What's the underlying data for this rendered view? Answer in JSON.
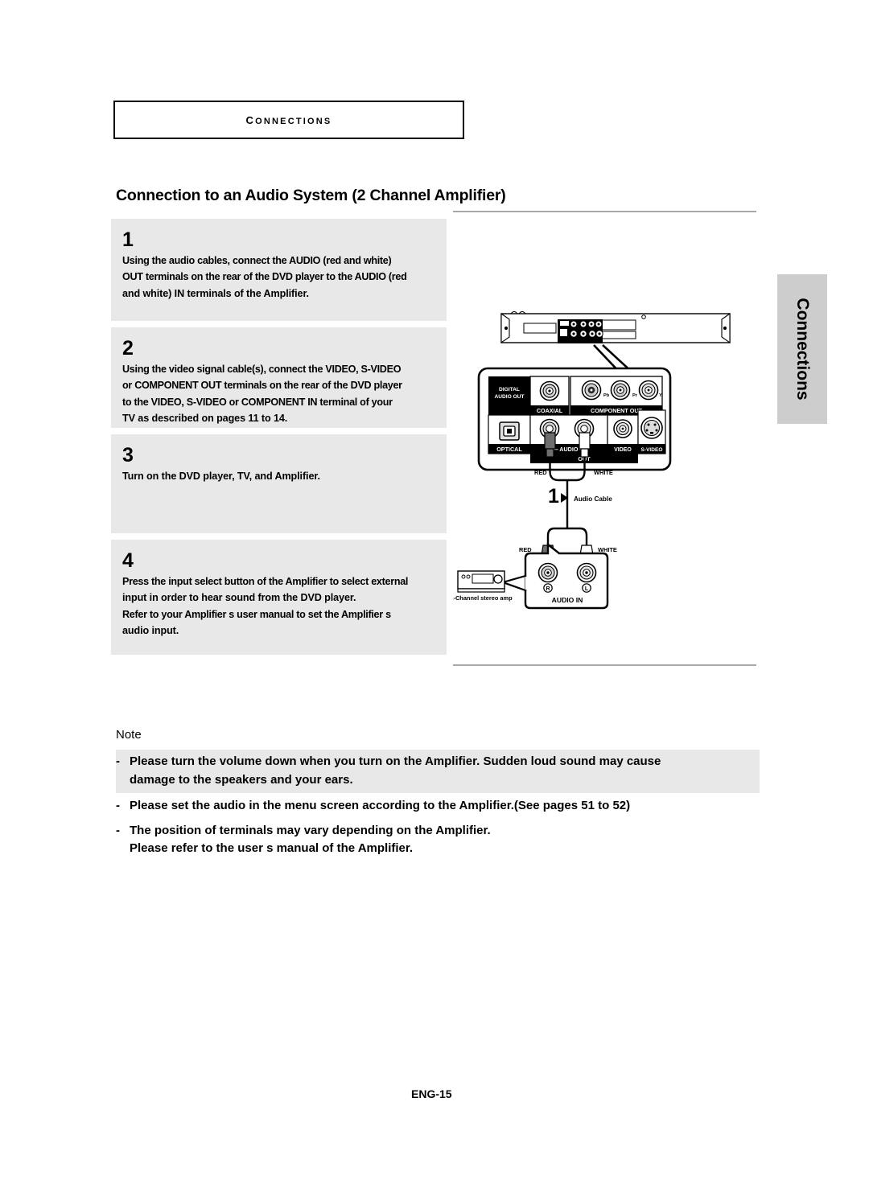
{
  "chapter": {
    "label": "Connections"
  },
  "section": {
    "title": "Connection to an Audio System (2 Channel Amplifier)"
  },
  "side_tab": {
    "label": "Connections"
  },
  "footer": {
    "page_label": "ENG-15"
  },
  "steps": [
    {
      "number": "1",
      "lines": [
        "Using the audio cables, connect the AUDIO (red and white)",
        "OUT terminals on the rear of the DVD player to the AUDIO (red",
        "and white) IN terminals of the Amplifier."
      ]
    },
    {
      "number": "2",
      "lines": [
        "Using the video signal cable(s), connect the VIDEO, S-VIDEO",
        "or COMPONENT OUT terminals on the rear of the DVD player",
        "to the VIDEO, S-VIDEO or COMPONENT IN terminal of your",
        "TV as described on pages 11 to 14."
      ]
    },
    {
      "number": "3",
      "lines": [
        "Turn on the DVD player, TV, and Amplifier."
      ]
    },
    {
      "number": "4",
      "lines": [
        "Press the input select button of the Amplifier to select external",
        "input  in order to hear sound from the DVD player.",
        "Refer to your Amplifier s user manual to set the Amplifier s",
        "audio input."
      ]
    }
  ],
  "note": {
    "heading": "Note",
    "items": [
      {
        "dash": "-",
        "shaded": true,
        "lines": [
          "Please turn the volume down when you turn on the Amplifier. Sudden loud sound may cause",
          "damage to the speakers and your ears."
        ]
      },
      {
        "dash": "-",
        "shaded": false,
        "lines": [
          "Please set the audio in the menu screen according to the Amplifier.(See pages 51 to 52)"
        ]
      },
      {
        "dash": "-",
        "shaded": false,
        "lines": [
          "The position of terminals may vary depending on the Amplifier.",
          "Please refer to the user s manual of the Amplifier."
        ]
      }
    ]
  },
  "diagram": {
    "rear_panel": {
      "digital_audio_out": "DIGITAL\nAUDIO OUT",
      "digital_audio_out_l1": "DIGITAL",
      "digital_audio_out_l2": "AUDIO OUT",
      "coaxial": "COAXIAL",
      "optical": "OPTICAL",
      "component_out": "COMPONENT OUT",
      "component_pb": "Pb",
      "component_pr": "Pr",
      "component_y": "Y",
      "audio": "AUDIO",
      "video": "VIDEO",
      "svideo": "S-VIDEO",
      "out": "OUT"
    },
    "cable": {
      "step_marker": "1",
      "label": "Audio Cable",
      "out_red": "RED",
      "out_white": "WHITE",
      "in_red": "RED",
      "in_white": "WHITE"
    },
    "amplifier": {
      "audio_in": "AUDIO IN",
      "jack_right": "R",
      "jack_left": "L",
      "caption": "2-Channel stereo amp"
    }
  },
  "colors": {
    "step_box_bg": "#e8e8e8",
    "side_tab_bg": "#cdcdcd",
    "rule": "#a8a8a8",
    "red_plug": "#6b6b6b",
    "white_plug": "#ffffff",
    "panel_black": "#000000"
  }
}
